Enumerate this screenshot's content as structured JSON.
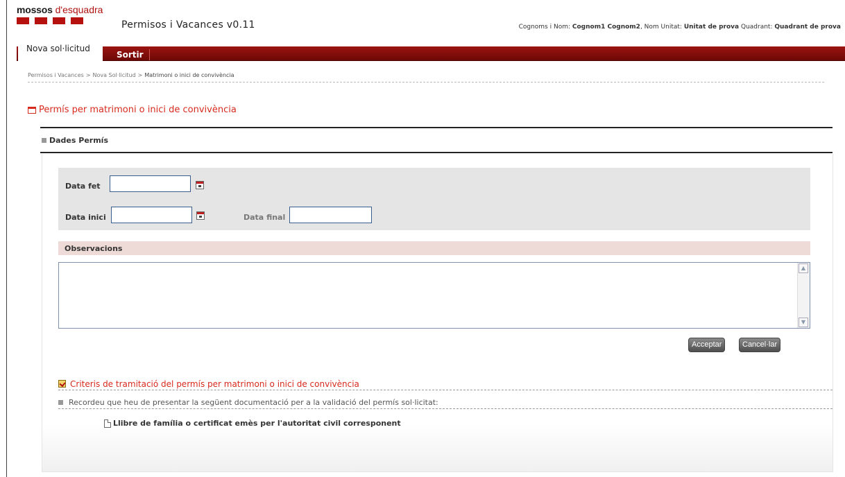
{
  "header": {
    "logo_brand": "mossos",
    "logo_sub": "d'esquadra",
    "app_title": "Permisos i Vacances v0.11",
    "user": {
      "label_name": "Cognoms i Nom:",
      "name": "Cognom1 Cognom2",
      "label_unit": ", Nom Unitat:",
      "unit": "Unitat de prova",
      "label_quadrant": "Quadrant:",
      "quadrant": "Quadrant de prova"
    }
  },
  "nav": {
    "tab_active": "Nova sol·licitud",
    "tab_exit": "Sortir"
  },
  "breadcrumb": {
    "items": [
      "Permisos i Vacances",
      "Nova Sol·licitud",
      "Matrimoni o inici de convivència"
    ],
    "separator": ">"
  },
  "page": {
    "title": "Permís per matrimoni o inici de convivència",
    "section": "Dades Permís"
  },
  "form": {
    "data_fet_label": "Data fet",
    "data_fet_value": "",
    "data_inici_label": "Data inici",
    "data_inici_value": "",
    "data_final_label": "Data final",
    "data_final_value": "",
    "observacions_label": "Observacions",
    "observacions_value": "",
    "accept_label": "Acceptar",
    "cancel_label": "Cancel·lar"
  },
  "criteria": {
    "title": "Criteris de tramitació del permís per matrimoni o inici de convivència",
    "note": "Recordeu que heu de presentar la següent documentació per a la validació del permís sol·licitat:",
    "documents": [
      "Llibre de família o certificat emès per l'autoritat civil corresponent"
    ]
  },
  "icons": {
    "title_icon": "document-window-icon",
    "calendar": "calendar-icon",
    "criteria": "checklist-icon",
    "document": "file-icon"
  },
  "colors": {
    "brand_red": "#b4110f",
    "nav_red": "#8a0f0b",
    "title_red": "#d82a1e",
    "obs_header_bg": "#eedbd7",
    "panel_gray": "#e5e5e5",
    "button_gray": "#5e5e5e"
  }
}
